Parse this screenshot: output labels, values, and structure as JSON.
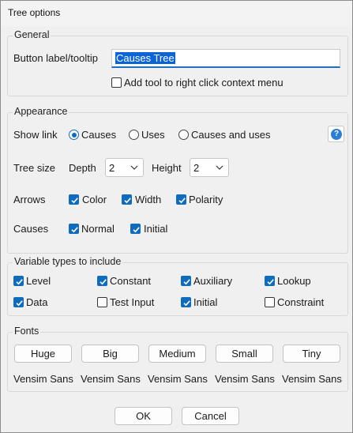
{
  "window": {
    "title": "Tree options"
  },
  "general": {
    "title": "General",
    "button_label": "Button label/tooltip",
    "button_value": "Causes Tree",
    "add_tool_label": "Add tool to right click context menu",
    "add_tool_checked": false
  },
  "appearance": {
    "title": "Appearance",
    "show_link_label": "Show link",
    "show_link_options": [
      {
        "label": "Causes",
        "selected": true
      },
      {
        "label": "Uses",
        "selected": false
      },
      {
        "label": "Causes and uses",
        "selected": false
      }
    ],
    "help_icon": "?",
    "tree_size_label": "Tree size",
    "depth_label": "Depth",
    "depth_value": "2",
    "height_label": "Height",
    "height_value": "2",
    "arrows_label": "Arrows",
    "arrows": [
      {
        "label": "Color",
        "checked": true
      },
      {
        "label": "Width",
        "checked": true
      },
      {
        "label": "Polarity",
        "checked": true
      }
    ],
    "causes_label": "Causes",
    "causes": [
      {
        "label": "Normal",
        "checked": true
      },
      {
        "label": "Initial",
        "checked": true
      }
    ]
  },
  "variable_types": {
    "title": "Variable types to include",
    "items": [
      {
        "label": "Level",
        "checked": true
      },
      {
        "label": "Constant",
        "checked": true
      },
      {
        "label": "Auxiliary",
        "checked": true
      },
      {
        "label": "Lookup",
        "checked": true
      },
      {
        "label": "Data",
        "checked": true
      },
      {
        "label": "Test Input",
        "checked": false
      },
      {
        "label": "Initial",
        "checked": true
      },
      {
        "label": "Constraint",
        "checked": false
      }
    ]
  },
  "fonts": {
    "title": "Fonts",
    "items": [
      {
        "button": "Huge",
        "font": "Vensim Sans"
      },
      {
        "button": "Big",
        "font": "Vensim Sans"
      },
      {
        "button": "Medium",
        "font": "Vensim Sans"
      },
      {
        "button": "Small",
        "font": "Vensim Sans"
      },
      {
        "button": "Tiny",
        "font": "Vensim Sans"
      }
    ]
  },
  "footer": {
    "ok_label": "OK",
    "cancel_label": "Cancel"
  },
  "colors": {
    "accent": "#0f6cbd",
    "selection": "#0a64d8",
    "background": "#f0f0f0"
  }
}
